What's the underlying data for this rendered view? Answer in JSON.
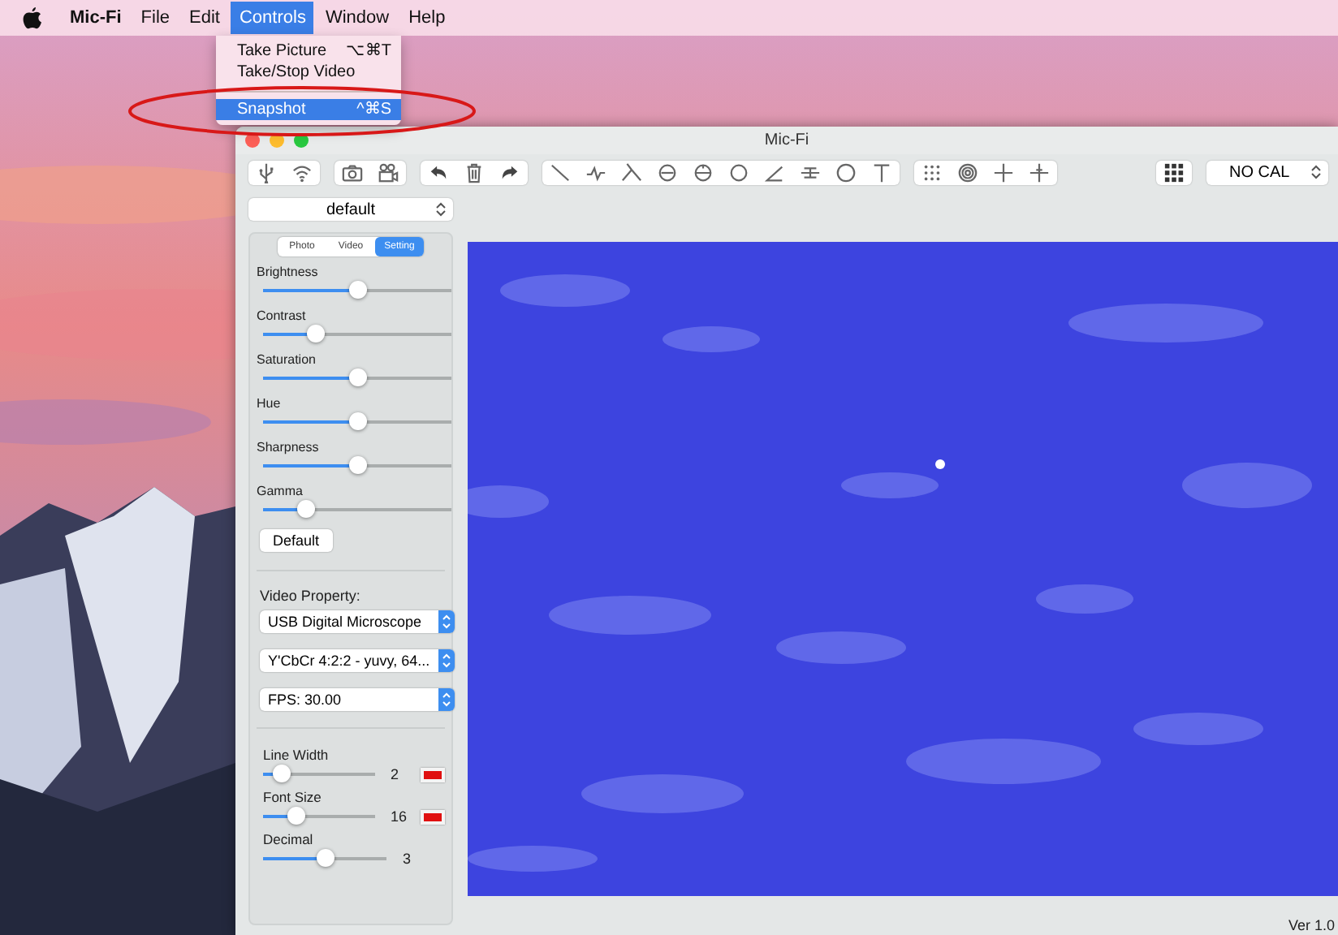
{
  "menu_bar": {
    "items": [
      {
        "label": "Mic-Fi",
        "kind": "app",
        "selected": false
      },
      {
        "label": "File",
        "kind": "menu",
        "selected": false
      },
      {
        "label": "Edit",
        "kind": "menu",
        "selected": false
      },
      {
        "label": "Controls",
        "kind": "menu",
        "selected": true
      },
      {
        "label": "Window",
        "kind": "menu",
        "selected": false
      },
      {
        "label": "Help",
        "kind": "menu",
        "selected": false
      }
    ]
  },
  "menu": {
    "items": [
      {
        "kind": "item",
        "label": "Take Picture",
        "shortcut": "⌥⌘T",
        "selected": false
      },
      {
        "kind": "item",
        "label": "Take/Stop Video",
        "selected": false
      },
      {
        "kind": "separator"
      },
      {
        "kind": "item",
        "label": "Snapshot",
        "shortcut": "^⌘S",
        "selected": true
      }
    ]
  },
  "window": {
    "title": "Mic-Fi"
  },
  "calibration": {
    "value": "NO CAL"
  },
  "preset": {
    "value": "default"
  },
  "tabs": [
    {
      "label": "Photo",
      "selected": false
    },
    {
      "label": "Video",
      "selected": false
    },
    {
      "label": "Setting",
      "selected": true
    }
  ],
  "adjustments": [
    {
      "label": "Brightness",
      "level": 0.5
    },
    {
      "label": "Contrast",
      "level": 0.28
    },
    {
      "label": "Saturation",
      "level": 0.5
    },
    {
      "label": "Hue",
      "level": 0.5
    },
    {
      "label": "Sharpness",
      "level": 0.5
    },
    {
      "label": "Gamma",
      "level": 0.23
    }
  ],
  "default_button": "Default",
  "video_property": {
    "label": "Video Property:",
    "selects": [
      "USB Digital Microscope",
      "Y'CbCr 4:2:2 - yuvy, 64...",
      "FPS: 30.00"
    ]
  },
  "drawing": [
    {
      "label": "Line Width",
      "level": 0.17,
      "reading": "2",
      "color": "#e01010"
    },
    {
      "label": "Font Size",
      "level": 0.3,
      "reading": "16",
      "color": "#e01010"
    },
    {
      "label": "Decimal",
      "level": 0.5,
      "reading": "3"
    }
  ],
  "version": "Ver 1.0"
}
